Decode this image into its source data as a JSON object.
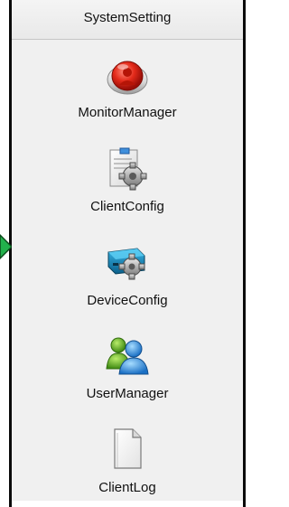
{
  "panel": {
    "title": "SystemSetting",
    "items": [
      {
        "label": "MonitorManager",
        "icon": "monitor-record-icon"
      },
      {
        "label": "ClientConfig",
        "icon": "client-config-icon"
      },
      {
        "label": "DeviceConfig",
        "icon": "device-config-icon"
      },
      {
        "label": "UserManager",
        "icon": "user-manager-icon"
      },
      {
        "label": "ClientLog",
        "icon": "client-log-icon"
      }
    ]
  },
  "colors": {
    "panel_bg": "#f0f0f0",
    "header_bg": "#ececec",
    "arrow_fill": "#22b14c",
    "border": "#0a0a0a"
  }
}
